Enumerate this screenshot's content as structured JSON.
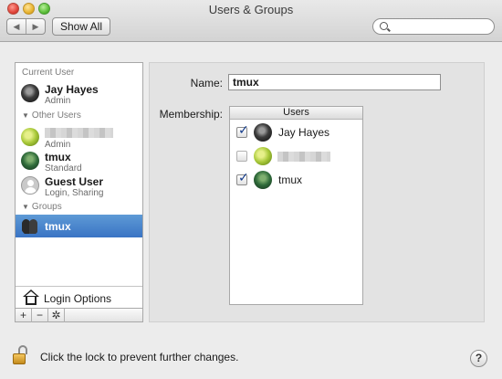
{
  "window": {
    "title": "Users & Groups"
  },
  "toolbar": {
    "back_glyph": "◀",
    "forward_glyph": "▶",
    "show_all_label": "Show All",
    "search_placeholder": ""
  },
  "sidebar": {
    "current_user_header": "Current User",
    "current_user": {
      "name": "Jay Hayes",
      "role": "Admin",
      "avatar": "dark-portrait"
    },
    "other_users_header": "Other Users",
    "other_users": [
      {
        "name": "",
        "role": "Admin",
        "avatar": "lime-leaf",
        "name_obscured": true
      },
      {
        "name": "tmux",
        "role": "Standard",
        "avatar": "fern"
      },
      {
        "name": "Guest User",
        "role": "Login, Sharing",
        "avatar": "guest-silhouette"
      }
    ],
    "groups_header": "Groups",
    "groups": [
      {
        "name": "tmux",
        "selected": true
      }
    ],
    "login_options_label": "Login Options",
    "actions": {
      "add": "+",
      "remove": "−",
      "gear": "✲"
    }
  },
  "main": {
    "name_label": "Name:",
    "name_value": "tmux",
    "membership_label": "Membership:",
    "members_header": "Users",
    "members": [
      {
        "name": "Jay Hayes",
        "checked": true,
        "avatar": "dark-portrait"
      },
      {
        "name": "",
        "checked": false,
        "avatar": "lime-leaf",
        "name_obscured": true
      },
      {
        "name": "tmux",
        "checked": true,
        "avatar": "fern"
      }
    ]
  },
  "footer": {
    "lock_text": "Click the lock to prevent further changes.",
    "help_label": "?"
  },
  "colors": {
    "selection": "#3a74c4",
    "checkmark": "#123a8a",
    "window_bg": "#ececec"
  }
}
